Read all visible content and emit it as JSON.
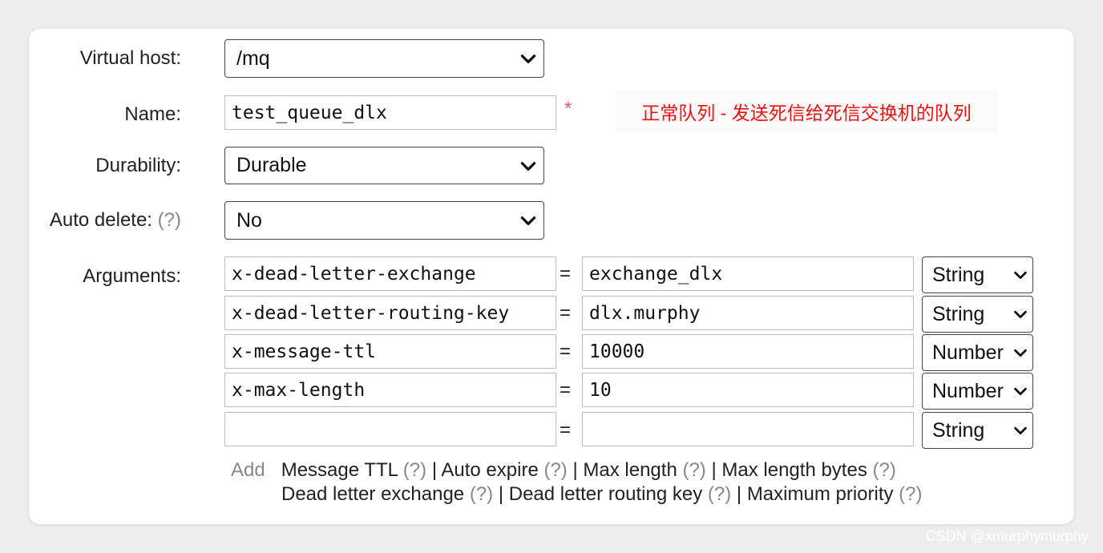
{
  "form": {
    "virtual_host": {
      "label": "Virtual host:",
      "value": "/mq"
    },
    "name": {
      "label": "Name:",
      "value": "test_queue_dlx",
      "required_mark": "*"
    },
    "annotation": "正常队列 - 发送死信给死信交换机的队列",
    "durability": {
      "label": "Durability:",
      "value": "Durable"
    },
    "auto_delete": {
      "label": "Auto delete:",
      "help": "(?)",
      "value": "No"
    },
    "arguments_label": "Arguments:",
    "equals": "=",
    "arguments": [
      {
        "key": "x-dead-letter-exchange",
        "value": "exchange_dlx",
        "type": "String"
      },
      {
        "key": "x-dead-letter-routing-key",
        "value": "dlx.murphy",
        "type": "String"
      },
      {
        "key": "x-message-ttl",
        "value": "10000",
        "type": "Number"
      },
      {
        "key": "x-max-length",
        "value": "10",
        "type": "Number"
      },
      {
        "key": "",
        "value": "",
        "type": "String"
      }
    ],
    "add": {
      "label": "Add",
      "help": "(?)",
      "separator": "|",
      "links": [
        "Message TTL",
        "Auto expire",
        "Max length",
        "Max length bytes",
        "Dead letter exchange",
        "Dead letter routing key",
        "Maximum priority"
      ]
    }
  },
  "watermark": "CSDN @xmurphymurphy"
}
